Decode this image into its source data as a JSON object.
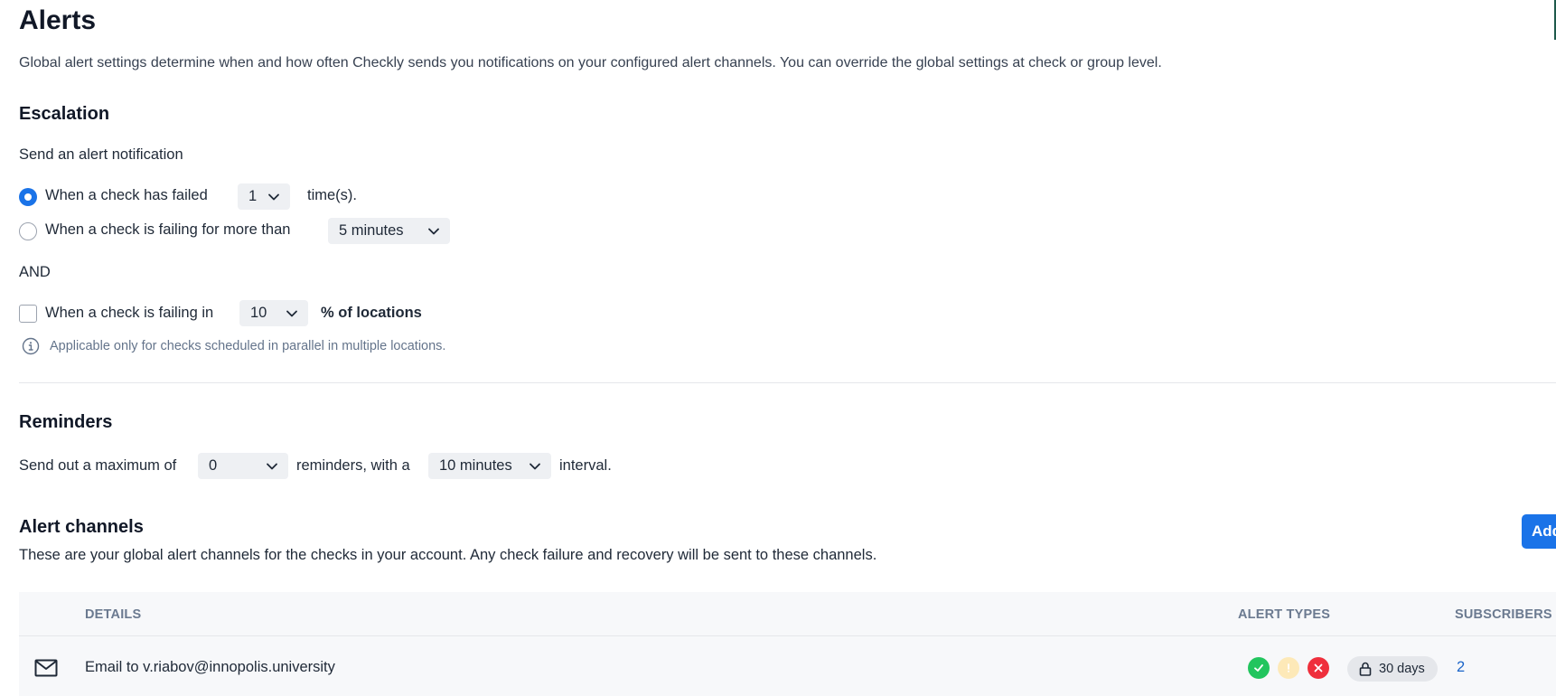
{
  "page": {
    "title": "Alerts",
    "intro": "Global alert settings determine when and how often Checkly sends you notifications on your configured alert channels. You can override the global settings at check or group level."
  },
  "escalation": {
    "title": "Escalation",
    "subtitle": "Send an alert notification",
    "option_failed": {
      "label": "When a check has failed",
      "selected": true,
      "value": "1",
      "suffix": "time(s)."
    },
    "option_failing_time": {
      "label": "When a check is failing for more than",
      "selected": false,
      "value": "5 minutes"
    },
    "and_label": "AND",
    "location_threshold": {
      "label": "When a check is failing in",
      "checked": false,
      "value": "10",
      "suffix": "% of locations"
    },
    "info_text": "Applicable only for checks scheduled in parallel in multiple locations."
  },
  "reminders": {
    "title": "Reminders",
    "prefix": "Send out a maximum of",
    "count_value": "0",
    "middle": "reminders, with a",
    "interval_value": "10 minutes",
    "suffix": "interval."
  },
  "channels": {
    "title": "Alert channels",
    "description": "These are your global alert channels for the checks in your account. Any check failure and recovery will be sent to these channels.",
    "add_button_label": "Add",
    "columns": {
      "details": "DETAILS",
      "alert_types": "ALERT TYPES",
      "subscribers": "SUBSCRIBERS"
    },
    "rows": [
      {
        "icon": "mail-icon",
        "details": "Email to v.riabov@innopolis.university",
        "alert_types": {
          "recovery": true,
          "degraded": false,
          "failure": true
        },
        "ssl_badge": "30 days",
        "subscribers": "2"
      }
    ]
  },
  "colors": {
    "accent": "#1a73e8",
    "success": "#22c55e",
    "warning_disabled": "#fde9b8",
    "failure": "#ef2f3c",
    "link": "#1a64c8"
  }
}
